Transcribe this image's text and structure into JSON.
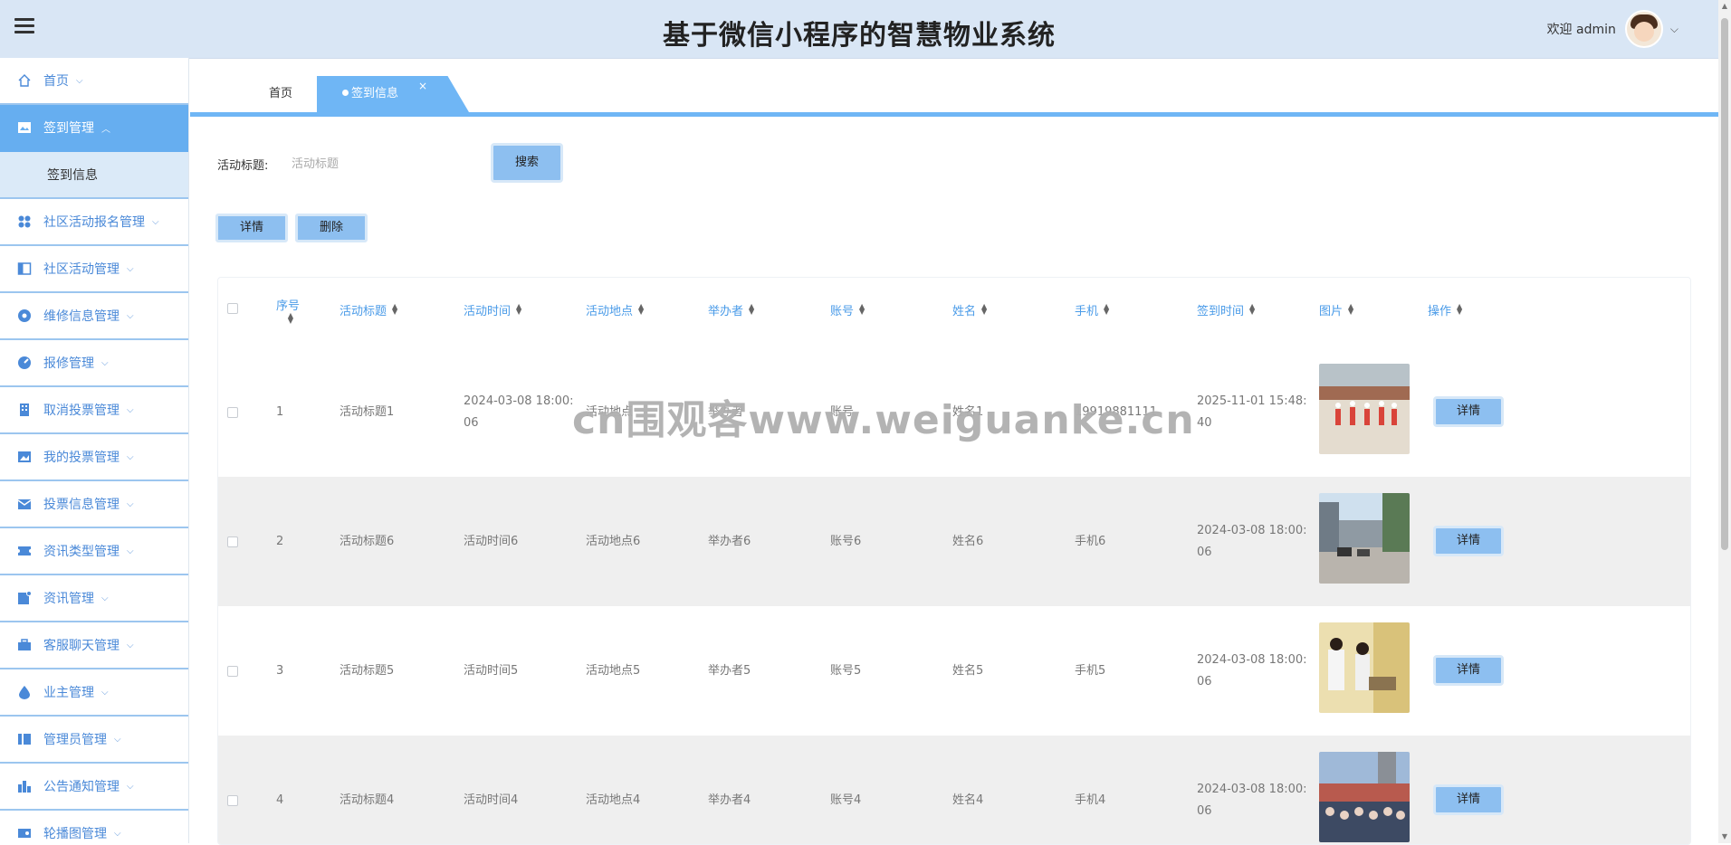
{
  "header": {
    "title": "基于微信小程序的智慧物业系统",
    "greeting": "欢迎 admin"
  },
  "sidebar": {
    "items": [
      {
        "label": "首页",
        "icon": "home-icon"
      },
      {
        "label": "签到管理",
        "icon": "image-icon",
        "active": true,
        "children": [
          {
            "label": "签到信息"
          }
        ]
      },
      {
        "label": "社区活动报名管理",
        "icon": "grid-icon"
      },
      {
        "label": "社区活动管理",
        "icon": "panel-icon"
      },
      {
        "label": "维修信息管理",
        "icon": "circle-icon"
      },
      {
        "label": "报修管理",
        "icon": "gauge-icon"
      },
      {
        "label": "取消投票管理",
        "icon": "building-icon"
      },
      {
        "label": "我的投票管理",
        "icon": "picture-icon"
      },
      {
        "label": "投票信息管理",
        "icon": "mail-icon"
      },
      {
        "label": "资讯类型管理",
        "icon": "ticket-icon"
      },
      {
        "label": "资讯管理",
        "icon": "note-icon"
      },
      {
        "label": "客服聊天管理",
        "icon": "briefcase-icon"
      },
      {
        "label": "业主管理",
        "icon": "drop-icon"
      },
      {
        "label": "管理员管理",
        "icon": "columns-icon"
      },
      {
        "label": "公告通知管理",
        "icon": "chart-icon"
      },
      {
        "label": "轮播图管理",
        "icon": "slider-icon"
      }
    ]
  },
  "tabs": {
    "home": "首页",
    "active": "签到信息",
    "close": "×"
  },
  "search": {
    "label": "活动标题:",
    "placeholder": "活动标题",
    "button": "搜索"
  },
  "actions": {
    "detail": "详情",
    "delete": "删除"
  },
  "table": {
    "columns": [
      "序号",
      "活动标题",
      "活动时间",
      "活动地点",
      "举办者",
      "账号",
      "姓名",
      "手机",
      "签到时间",
      "图片",
      "操作"
    ],
    "rows": [
      {
        "index": "1",
        "title": "活动标题1",
        "time_line1": "2024-03-08 18:00:",
        "time_line2": "06",
        "place": "活动地点",
        "organizer": "举办者",
        "account": "账号",
        "name": "姓名1",
        "phone": "19919881111",
        "signin_line1": "2025-11-01 15:48:",
        "signin_line2": "40",
        "action": "详情",
        "photo": "dance-photo"
      },
      {
        "index": "2",
        "title": "活动标题6",
        "time_line1": "活动时间6",
        "time_line2": "",
        "place": "活动地点6",
        "organizer": "举办者6",
        "account": "账号6",
        "name": "姓名6",
        "phone": "手机6",
        "signin_line1": "2024-03-08 18:00:",
        "signin_line2": "06",
        "action": "详情",
        "photo": "street-photo"
      },
      {
        "index": "3",
        "title": "活动标题5",
        "time_line1": "活动时间5",
        "time_line2": "",
        "place": "活动地点5",
        "organizer": "举办者5",
        "account": "账号5",
        "name": "姓名5",
        "phone": "手机5",
        "signin_line1": "2024-03-08 18:00:",
        "signin_line2": "06",
        "action": "详情",
        "photo": "office-photo"
      },
      {
        "index": "4",
        "title": "活动标题4",
        "time_line1": "活动时间4",
        "time_line2": "",
        "place": "活动地点4",
        "organizer": "举办者4",
        "account": "账号4",
        "name": "姓名4",
        "phone": "手机4",
        "signin_line1": "2024-03-08 18:00:",
        "signin_line2": "06",
        "action": "详情",
        "photo": "crowd-photo"
      }
    ]
  },
  "watermark": "cn围观客www.weiguanke.cn",
  "colors": {
    "accent": "#6fb6f5",
    "header_bg": "#d9e6f5",
    "sidebar_text": "#4a89d8",
    "button": "#8dbff0"
  }
}
